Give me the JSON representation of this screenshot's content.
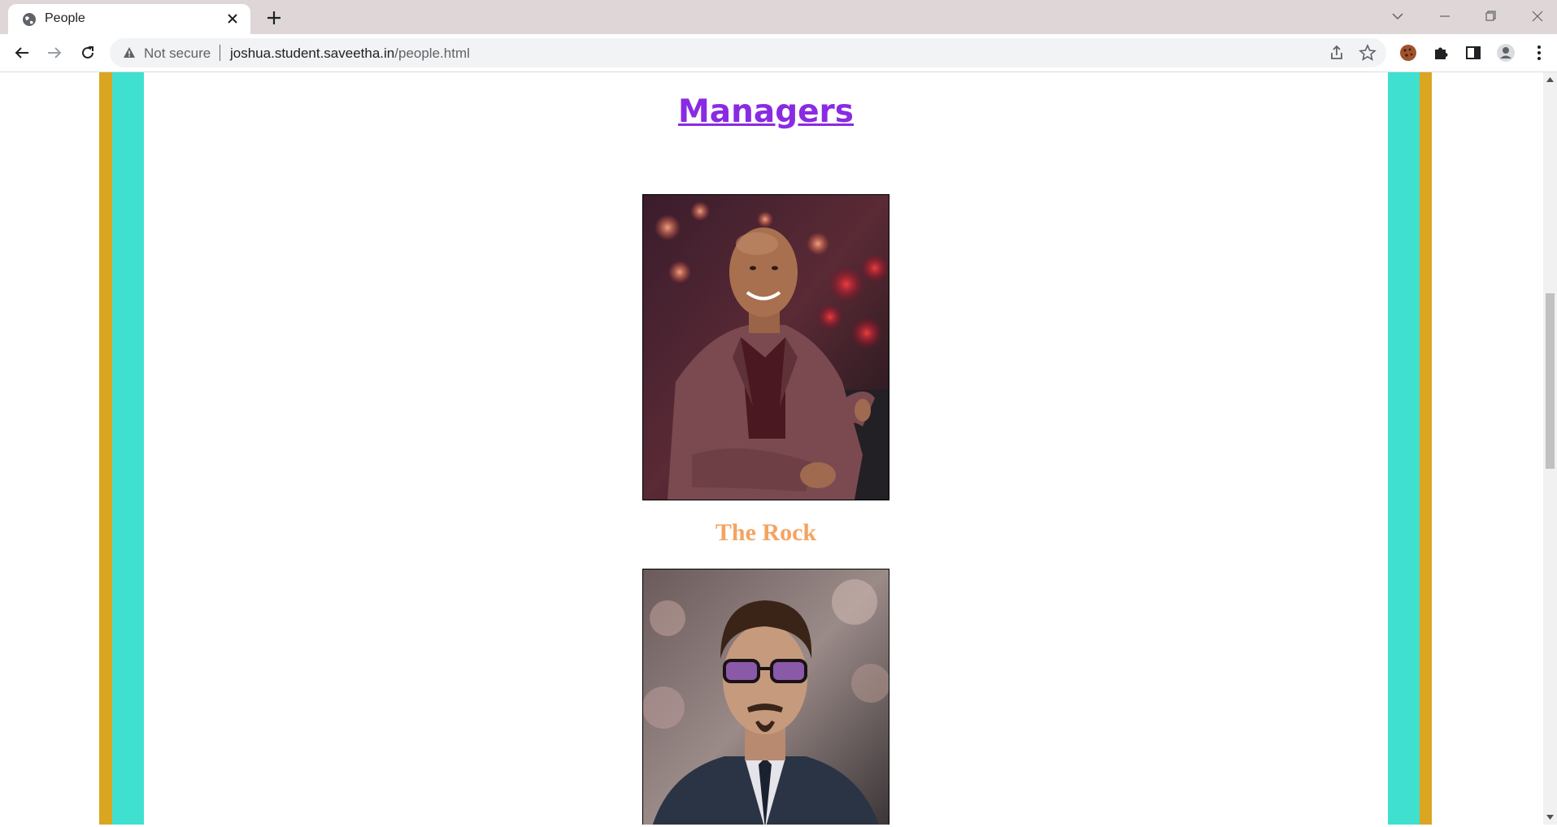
{
  "browser": {
    "tab_title": "People",
    "security_label": "Not secure",
    "url_host": "joshua.student.saveetha.in",
    "url_path": "/people.html"
  },
  "page": {
    "section_title": "Managers",
    "people": [
      {
        "name": "The Rock",
        "photo": "photo of smiling bald man in maroon suit"
      },
      {
        "name": "",
        "photo": "photo of man with tinted glasses and goatee in dark suit"
      }
    ]
  },
  "colors": {
    "heading": "#8a2be2",
    "name": "#f4a460",
    "border_gold": "#daa520",
    "border_teal": "#40e0d0"
  }
}
